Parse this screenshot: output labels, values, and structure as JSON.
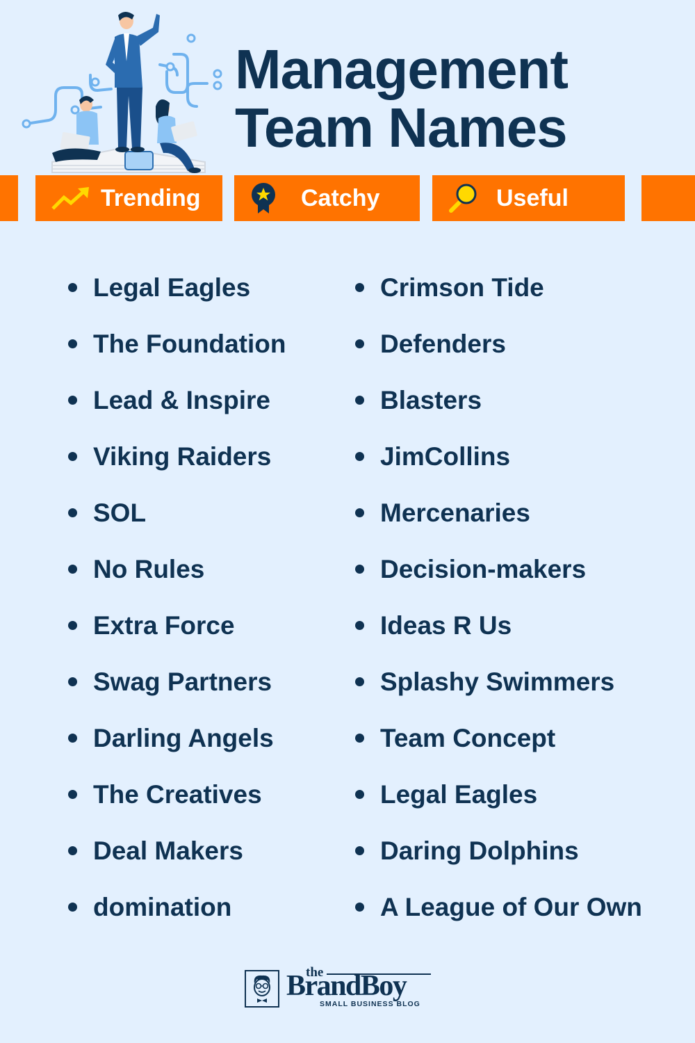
{
  "header": {
    "title_line1": "Management",
    "title_line2": "Team Names",
    "illustration": "management-team-illustration"
  },
  "tags": [
    {
      "label": "Trending",
      "icon": "trending-up-arrow-icon"
    },
    {
      "label": "Catchy",
      "icon": "award-ribbon-star-icon"
    },
    {
      "label": "Useful",
      "icon": "magnifying-glass-icon"
    }
  ],
  "names": {
    "left": [
      "Legal Eagles",
      "The Foundation",
      "Lead & Inspire",
      "Viking Raiders",
      "SOL",
      "No Rules",
      "Extra Force",
      "Swag Partners",
      "Darling Angels",
      "The Creatives",
      "Deal Makers",
      "domination"
    ],
    "right": [
      "Crimson Tide",
      "Defenders",
      "Blasters",
      "JimCollins",
      "Mercenaries",
      "Decision-makers",
      "Ideas R Us",
      "Splashy Swimmers",
      "Team Concept",
      "Legal Eagles",
      "Daring Dolphins",
      "A League of Our Own"
    ]
  },
  "brand": {
    "the": "the",
    "name": "BrandBoy",
    "tagline": "SMALL BUSINESS BLOG"
  },
  "colors": {
    "background": "#e3f0fe",
    "navy": "#0f3252",
    "orange": "#ff7300",
    "yellow": "#ffd900",
    "white": "#ffffff"
  }
}
